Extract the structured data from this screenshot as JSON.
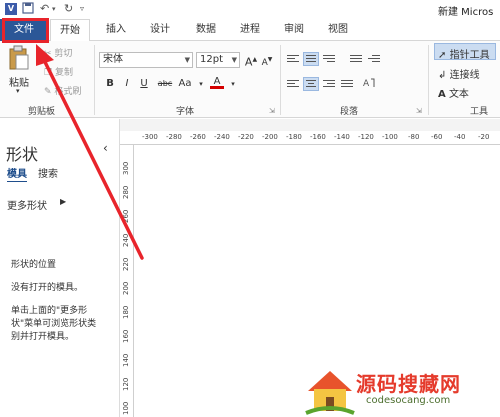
{
  "titlebar": {
    "logo": "V",
    "doc_title": "新建 Micros"
  },
  "tabs": [
    "文件",
    "开始",
    "插入",
    "设计",
    "数据",
    "进程",
    "审阅",
    "视图"
  ],
  "ribbon": {
    "clipboard": {
      "paste": "粘贴",
      "cut": "剪切",
      "copy": "复制",
      "format_painter": "格式刷",
      "label": "剪贴板"
    },
    "font": {
      "name": "宋体",
      "size": "12pt",
      "bold": "B",
      "italic": "I",
      "underline": "U",
      "strike": "abc",
      "case": "Aa",
      "color": "A",
      "label": "字体"
    },
    "paragraph": {
      "label": "段落"
    },
    "tools": {
      "pointer": "指针工具",
      "connector": "连接线",
      "text": "文本",
      "label": "工具"
    }
  },
  "panel": {
    "title": "形状",
    "tab_stencils": "模具",
    "tab_search": "搜索",
    "more_shapes": "更多形状",
    "location_heading": "形状的位置",
    "no_stencils": "没有打开的模具。",
    "help_lines": [
      "单击上面的\"更多形",
      "状\"菜单可浏览形状类",
      "别并打开模具。"
    ]
  },
  "ruler_h": [
    "-300",
    "-280",
    "-260",
    "-240",
    "-220",
    "-200",
    "-180",
    "-160",
    "-140",
    "-120",
    "-100",
    "-80",
    "-60",
    "-40",
    "-20"
  ],
  "ruler_v": [
    "300",
    "280",
    "260",
    "240",
    "220",
    "200",
    "180",
    "160",
    "140",
    "120",
    "100"
  ],
  "watermark": {
    "main": "源码搜藏网",
    "sub": "codesocang.com"
  }
}
